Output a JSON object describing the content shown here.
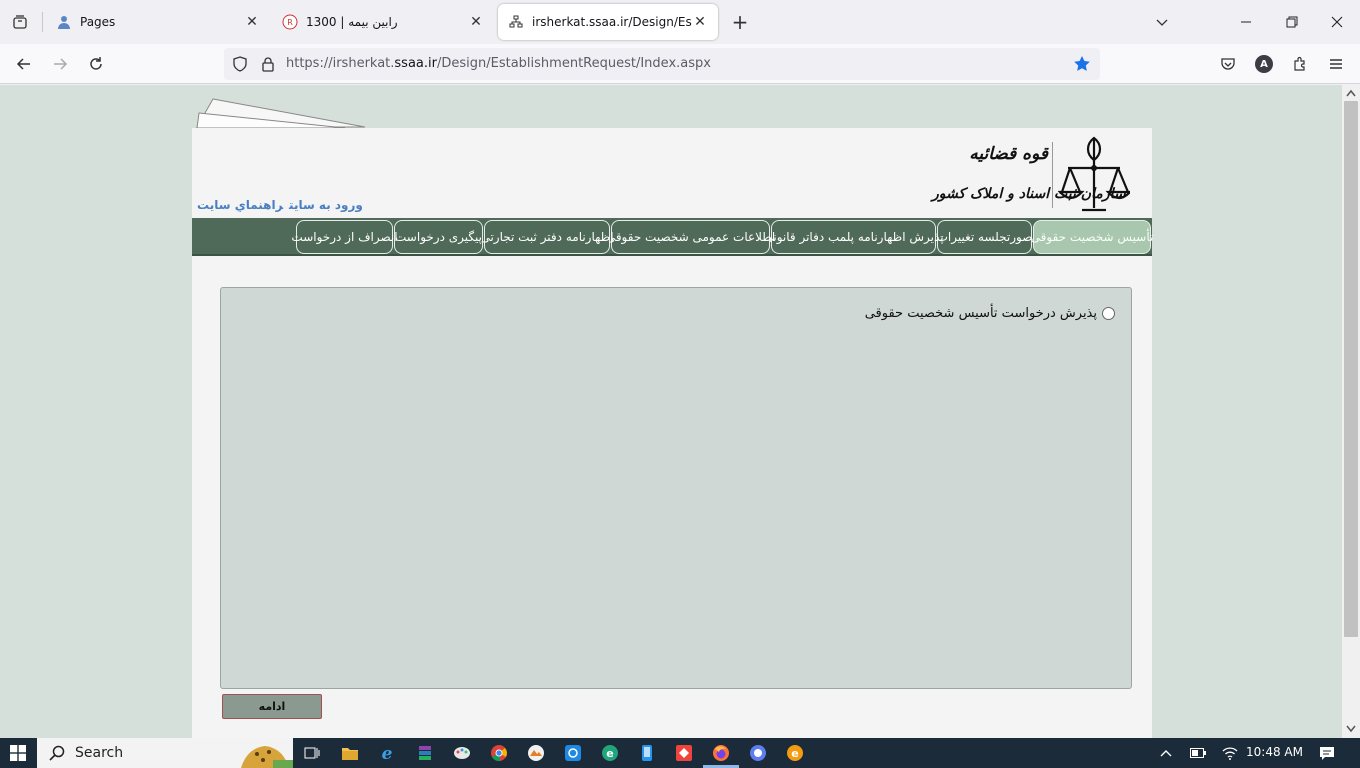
{
  "browser": {
    "tabs": [
      {
        "title": "Pages",
        "active": false
      },
      {
        "title": "رابین بیمه | 1300",
        "active": false
      },
      {
        "title": "irsherkat.ssaa.ir/Design/Establis",
        "active": true
      }
    ],
    "url_prefix": "https://irsherkat.",
    "url_host": "ssaa.ir",
    "url_path": "/Design/EstablishmentRequest/Index.aspx",
    "profile_initial": "A"
  },
  "header": {
    "logo_line1": "قوه قضائیه",
    "logo_line2": "سازمان ثبت اسناد و املاک کشور",
    "link_login": "ورود به سایت",
    "link_help": "راهنماي سایت"
  },
  "menu": {
    "items": [
      {
        "label": "تأسیس شخصیت حقوقی",
        "active": true
      },
      {
        "label": "صورتجلسه تغییرات",
        "active": false
      },
      {
        "label": "پذیرش اظهارنامه پلمب دفاتر قانونی",
        "active": false
      },
      {
        "label": "اطلاعات عمومی شخصیت حقوقی",
        "active": false
      },
      {
        "label": "اظهارنامه دفتر ثبت تجارتی",
        "active": false
      },
      {
        "label": "پیگیری درخواست",
        "active": false
      },
      {
        "label": "انصراف از درخواست",
        "active": false
      }
    ]
  },
  "form": {
    "option_label": "پذیرش درخواست تأسیس شخصیت حقوقی",
    "continue_label": "ادامه"
  },
  "taskbar": {
    "search_label": "Search",
    "time": "10:48 AM"
  },
  "colors": {
    "page_bg": "#d4e0d9",
    "menu_bg": "#4f6a58",
    "menu_active": "#a8c7ae",
    "panel_bg": "#cfd8d4",
    "link": "#4a7fc1"
  }
}
